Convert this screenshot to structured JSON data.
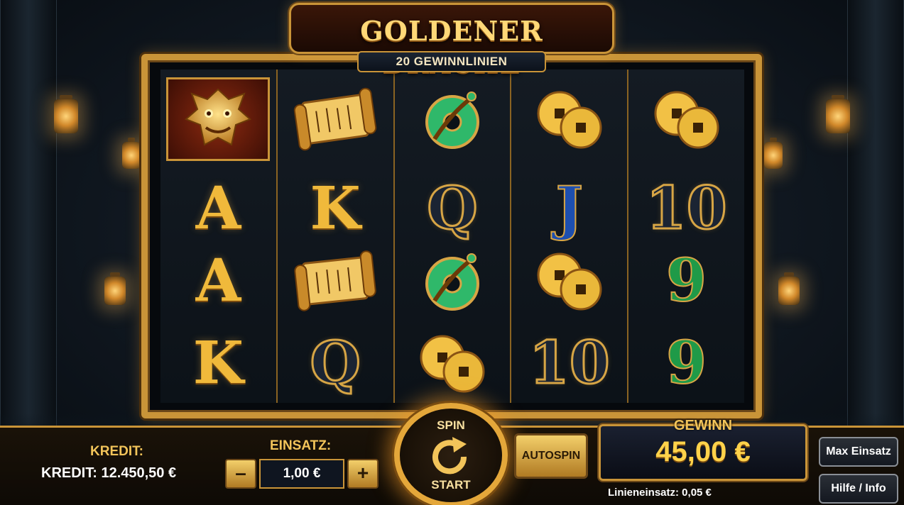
{
  "game": {
    "title": "GOLDENER DRACHE",
    "subtitle": "20 GEWINNLINIEN"
  },
  "reels": [
    [
      "dragon",
      "A",
      "A",
      "K"
    ],
    [
      "scroll",
      "K",
      "scroll",
      "Q"
    ],
    [
      "jade-coin",
      "Q",
      "jade-coin",
      "gold-coins"
    ],
    [
      "gold-coins",
      "J",
      "gold-coins",
      "10"
    ],
    [
      "gold-coins",
      "10",
      "9",
      "9"
    ]
  ],
  "controls": {
    "credit_label": "KREDIT:",
    "credit_value": "KREDIT: 12.450,50 €",
    "bet_label": "EINSATZ:",
    "bet_value": "1,00 €",
    "minus": "–",
    "plus": "+",
    "spin_top": "SPIN",
    "spin_bottom": "START",
    "autospin": "AUTOSPIN",
    "win_label": "GEWINN",
    "win_value": "45,00 €",
    "line_bet": "Linieneinsatz: 0,05 €",
    "max_bet": "Max Einsatz",
    "help": "Hilfe / Info"
  },
  "colors": {
    "gold": "#c99438",
    "win": "#ffd24a"
  }
}
